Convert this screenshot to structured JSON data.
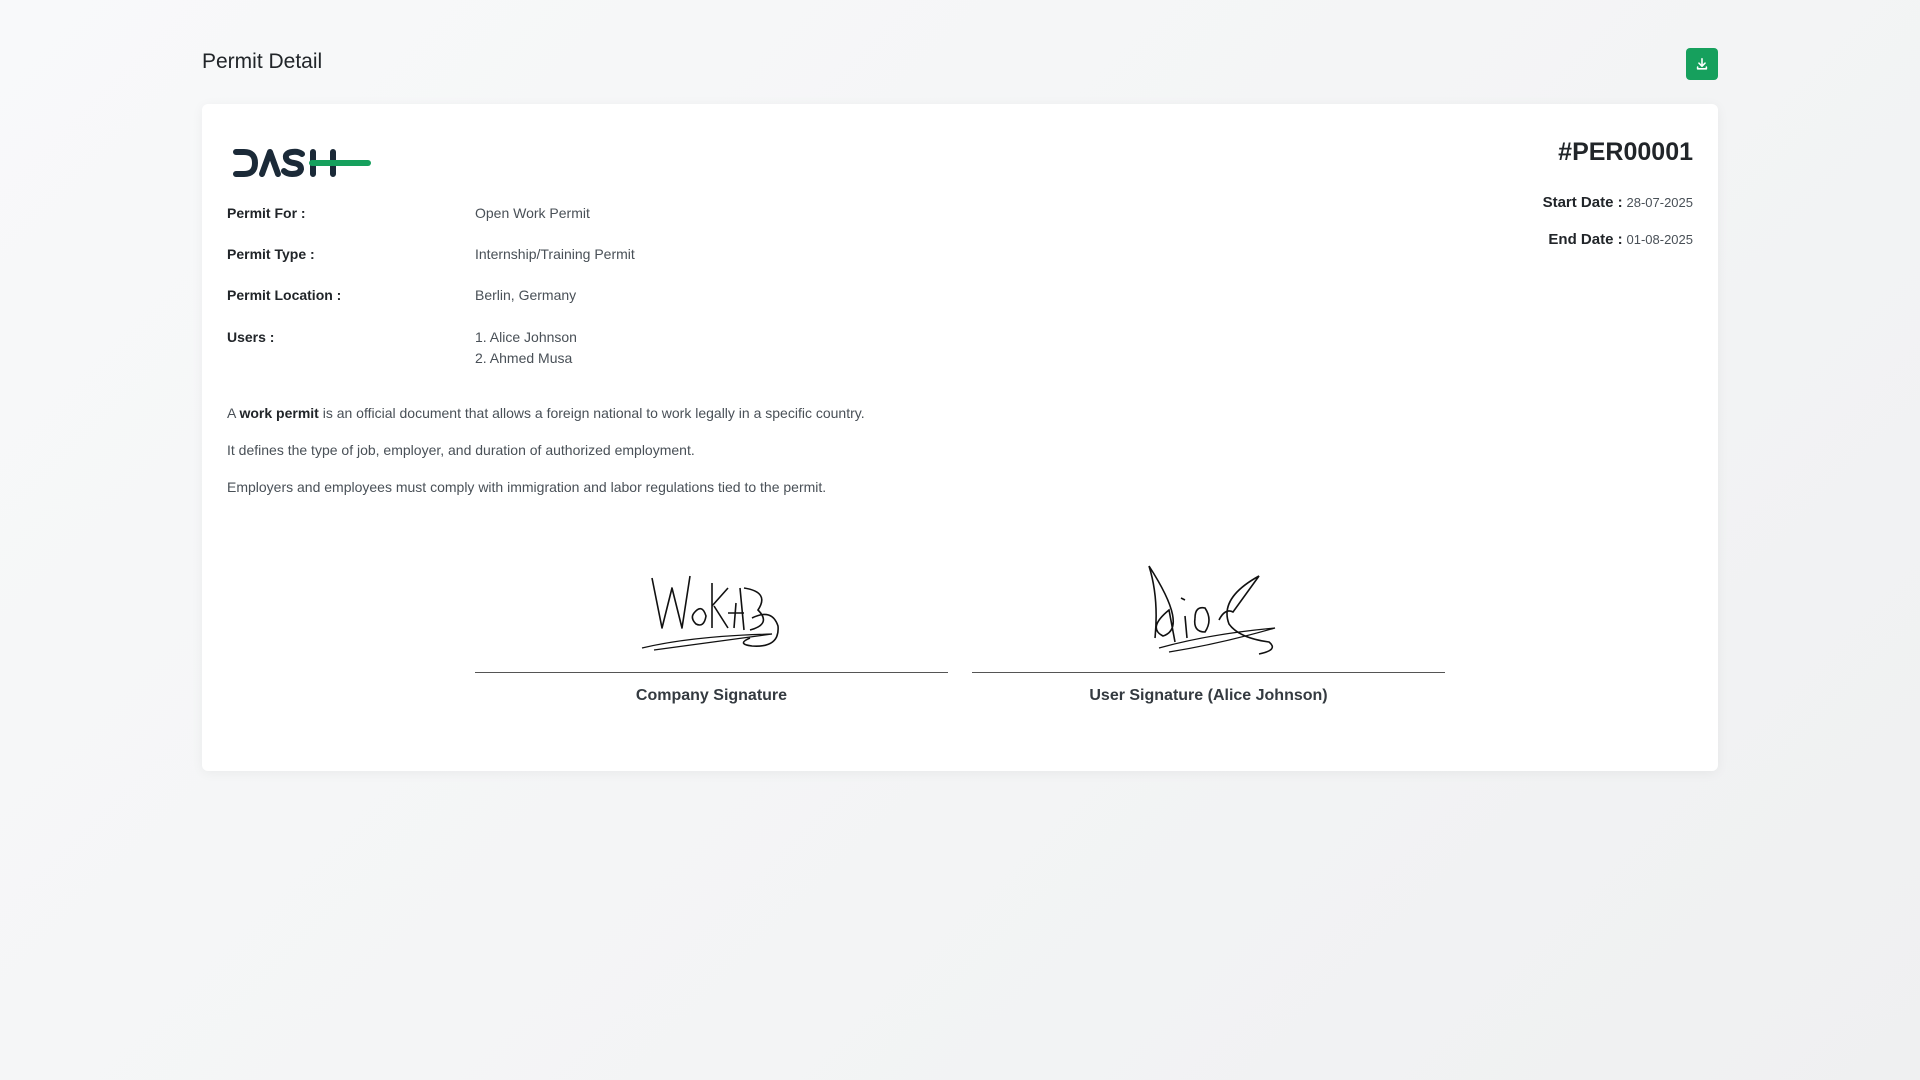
{
  "header": {
    "title": "Permit Detail",
    "download_icon": "download-icon"
  },
  "brand": {
    "logo_text": "DASH",
    "dark_color": "#1b2a38",
    "accent_color": "#16a05d"
  },
  "permit": {
    "id": "#PER00001",
    "start_date_label": "Start Date :",
    "start_date": "28-07-2025",
    "end_date_label": "End Date :",
    "end_date": "01-08-2025",
    "fields": {
      "permit_for_label": "Permit For :",
      "permit_for": "Open Work Permit",
      "permit_type_label": "Permit Type :",
      "permit_type": "Internship/Training Permit",
      "permit_location_label": "Permit Location :",
      "permit_location": "Berlin, Germany",
      "users_label": "Users :",
      "users": [
        "1. Alice Johnson",
        "2. Ahmed Musa"
      ]
    }
  },
  "description": {
    "p1_prefix": "A ",
    "p1_bold": "work permit",
    "p1_suffix": " is an official document that allows a foreign national to work legally in a specific country.",
    "p2": "It defines the type of job, employer, and duration of authorized employment.",
    "p3": "Employers and employees must comply with immigration and labor regulations tied to the permit."
  },
  "signatures": {
    "company_caption": "Company Signature",
    "user_caption": "User Signature (Alice Johnson)"
  }
}
